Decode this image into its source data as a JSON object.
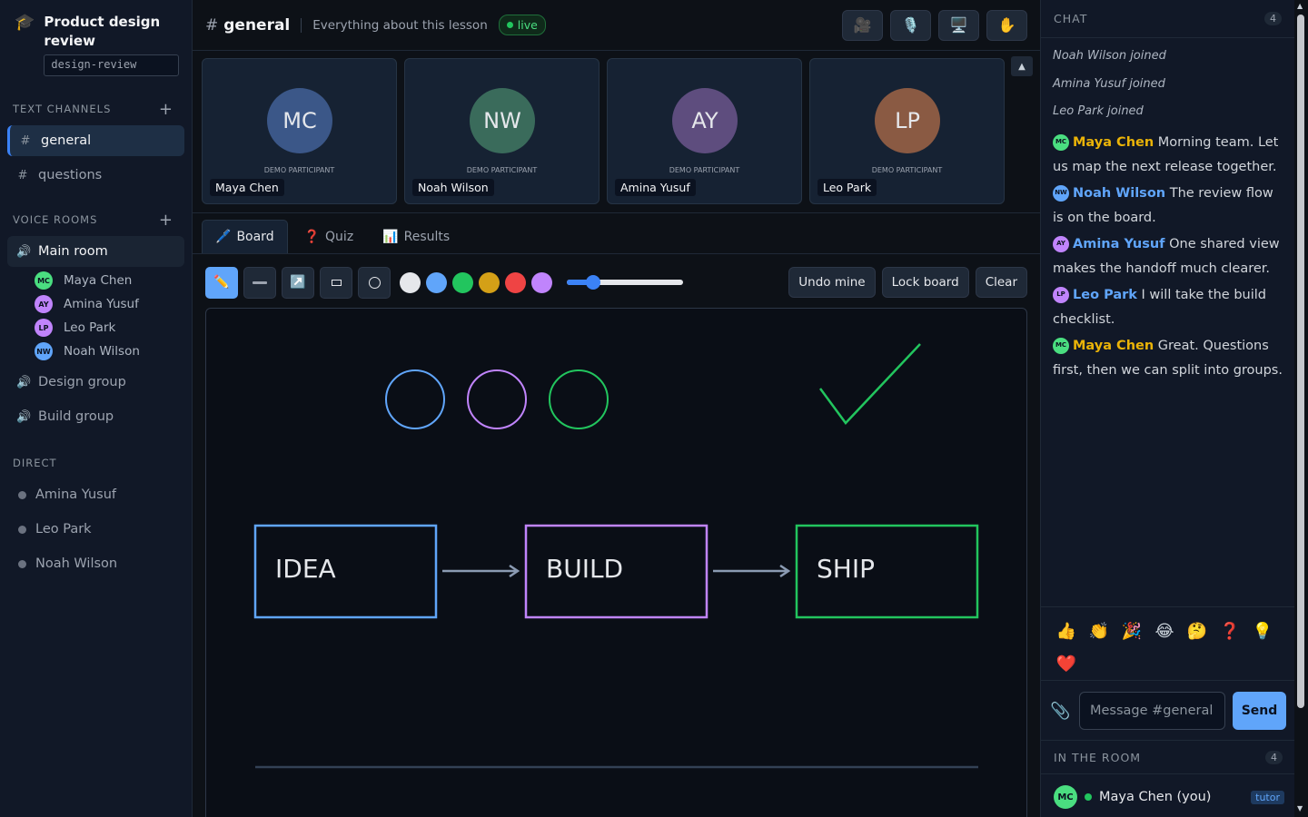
{
  "workspace": {
    "title": "Product design review",
    "slug": "design-review"
  },
  "sidebar": {
    "text_channels_label": "TEXT CHANNELS",
    "text_channels": [
      {
        "label": "general"
      },
      {
        "label": "questions"
      }
    ],
    "voice_rooms_label": "VOICE ROOMS",
    "voice_rooms": [
      {
        "label": "Main room"
      },
      {
        "label": "Design group"
      },
      {
        "label": "Build group"
      }
    ],
    "main_room_members": [
      {
        "initials": "MC",
        "name": "Maya Chen",
        "color": "#4ade80"
      },
      {
        "initials": "AY",
        "name": "Amina Yusuf",
        "color": "#c084fc"
      },
      {
        "initials": "LP",
        "name": "Leo Park",
        "color": "#c084fc"
      },
      {
        "initials": "NW",
        "name": "Noah Wilson",
        "color": "#60a5fa"
      }
    ],
    "direct_label": "DIRECT",
    "direct": [
      {
        "name": "Amina Yusuf"
      },
      {
        "name": "Leo Park"
      },
      {
        "name": "Noah Wilson"
      }
    ]
  },
  "header": {
    "channel": "general",
    "topic": "Everything about this lesson",
    "status": "live"
  },
  "participants": [
    {
      "initials": "MC",
      "name": "Maya Chen",
      "role": "DEMO PARTICIPANT",
      "color": "#3b5788"
    },
    {
      "initials": "NW",
      "name": "Noah Wilson",
      "role": "DEMO PARTICIPANT",
      "color": "#3a6b5b"
    },
    {
      "initials": "AY",
      "name": "Amina Yusuf",
      "role": "DEMO PARTICIPANT",
      "color": "#5e4d7e"
    },
    {
      "initials": "LP",
      "name": "Leo Park",
      "role": "DEMO PARTICIPANT",
      "color": "#8a5a43"
    }
  ],
  "tabs": [
    {
      "icon": "🖊️",
      "label": "Board"
    },
    {
      "icon": "❓",
      "label": "Quiz"
    },
    {
      "icon": "📊",
      "label": "Results"
    }
  ],
  "toolbar": {
    "colors": [
      "#e5e7eb",
      "#60a5fa",
      "#22c55e",
      "#d4a017",
      "#ef4444",
      "#c084fc"
    ],
    "brush_size_fraction": 0.19,
    "undo_label": "Undo mine",
    "lock_label": "Lock board",
    "clear_label": "Clear"
  },
  "board": {
    "boxes": [
      "IDEA",
      "BUILD",
      "SHIP"
    ]
  },
  "chat": {
    "title": "CHAT",
    "count": "4",
    "system": [
      "Noah Wilson joined",
      "Amina Yusuf joined",
      "Leo Park joined"
    ],
    "messages": [
      {
        "initials": "MC",
        "author": "Maya Chen",
        "text": "Morning team. Let us map the next release together.",
        "color": "#eab308",
        "avatar_color": "#4ade80"
      },
      {
        "initials": "NW",
        "author": "Noah Wilson",
        "text": "The review flow is on the board.",
        "color": "#60a5fa",
        "avatar_color": "#60a5fa"
      },
      {
        "initials": "AY",
        "author": "Amina Yusuf",
        "text": "One shared view makes the handoff much clearer.",
        "color": "#60a5fa",
        "avatar_color": "#c084fc"
      },
      {
        "initials": "LP",
        "author": "Leo Park",
        "text": "I will take the build checklist.",
        "color": "#60a5fa",
        "avatar_color": "#c084fc"
      },
      {
        "initials": "MC",
        "author": "Maya Chen",
        "text": "Great. Questions first, then we can split into groups.",
        "color": "#eab308",
        "avatar_color": "#4ade80"
      }
    ],
    "reactions": [
      "👍",
      "👏",
      "🎉",
      "😂",
      "🤔",
      "❓",
      "💡",
      "❤️"
    ],
    "placeholder": "Message #general",
    "send_label": "Send"
  },
  "room": {
    "title": "IN THE ROOM",
    "count": "4",
    "member": {
      "initials": "MC",
      "name": "Maya Chen (you)",
      "badge": "tutor"
    }
  }
}
